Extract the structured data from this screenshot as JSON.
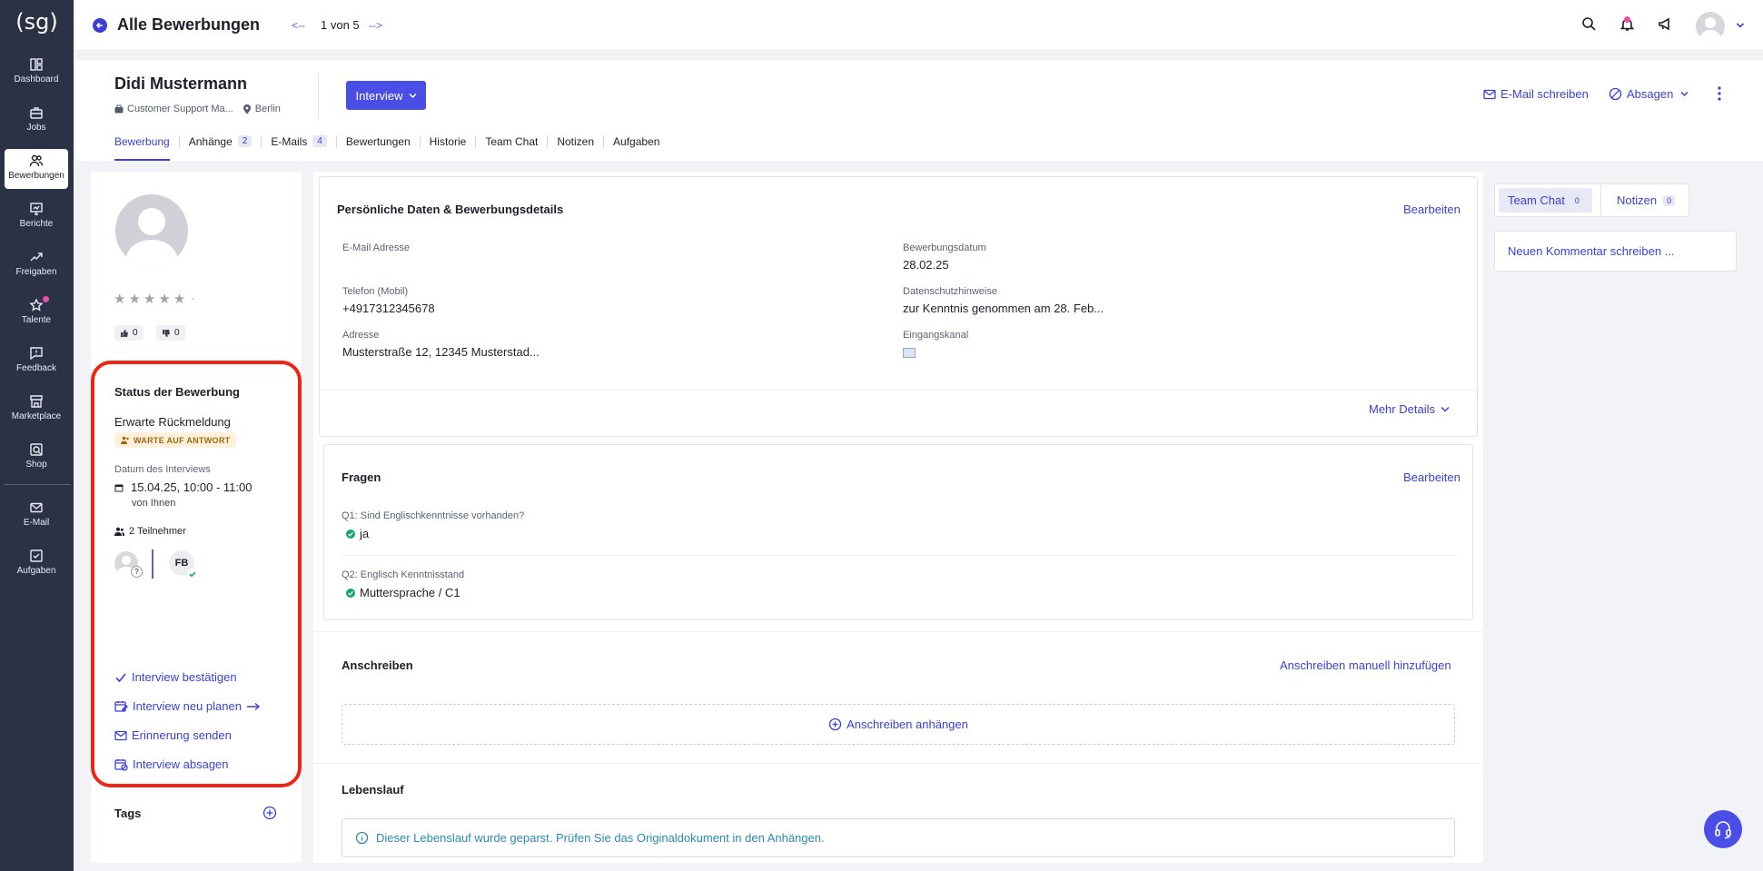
{
  "app": {
    "logo_text": "(sg)",
    "accent_color": "#3b3fd8",
    "highlight_color": "#ee2416"
  },
  "sidebar": {
    "items": [
      {
        "label": "Dashboard",
        "icon": "dashboard-icon"
      },
      {
        "label": "Jobs",
        "icon": "briefcase-icon"
      },
      {
        "label": "Bewerbungen",
        "icon": "users-icon",
        "active": true
      },
      {
        "label": "Berichte",
        "icon": "chart-icon"
      },
      {
        "label": "Freigaben",
        "icon": "handshake-icon"
      },
      {
        "label": "Talente",
        "icon": "star-icon"
      },
      {
        "label": "Feedback",
        "icon": "feedback-icon"
      },
      {
        "label": "Marketplace",
        "icon": "store-icon"
      },
      {
        "label": "Shop",
        "icon": "shop-icon"
      },
      {
        "label": "E-Mail",
        "icon": "mail-icon"
      },
      {
        "label": "Aufgaben",
        "icon": "tasks-icon"
      }
    ]
  },
  "topbar": {
    "title": "Alle Bewerbungen",
    "prev": "<--",
    "pager": "1 von 5",
    "next": "-->"
  },
  "header": {
    "candidate_name": "Didi Mustermann",
    "job": "Customer Support Ma...",
    "location": "Berlin",
    "stage_button": "Interview",
    "email_action": "E-Mail schreiben",
    "reject_action": "Absagen",
    "tabs": [
      {
        "label": "Bewerbung",
        "active": true
      },
      {
        "label": "Anhänge",
        "count": "2"
      },
      {
        "label": "E-Mails",
        "count": "4"
      },
      {
        "label": "Bewertungen"
      },
      {
        "label": "Historie"
      },
      {
        "label": "Team Chat"
      },
      {
        "label": "Notizen"
      },
      {
        "label": "Aufgaben"
      }
    ]
  },
  "left": {
    "rating_dash": "-",
    "likes": "0",
    "dislikes": "0",
    "status_title": "Status der Bewerbung",
    "status_text": "Erwarte Rückmeldung",
    "status_badge": "WARTE AUF ANTWORT",
    "interview_date_label": "Datum des Interviews",
    "interview_date": "15.04.25, 10:00 - 11:00",
    "interview_by": "von Ihnen",
    "participants": "2 Teilnehmer",
    "participant_question": "?",
    "participant_initials": "FB",
    "actions": {
      "confirm": "Interview bestätigen",
      "reschedule": "Interview neu planen",
      "reminder": "Erinnerung senden",
      "cancel": "Interview absagen"
    },
    "tags_title": "Tags"
  },
  "personal": {
    "title": "Persönliche Daten & Bewerbungsdetails",
    "edit": "Bearbeiten",
    "email_label": "E-Mail Adresse",
    "phone_label": "Telefon (Mobil)",
    "phone": "+4917312345678",
    "address_label": "Adresse",
    "address": "Musterstraße 12, 12345 Musterstad...",
    "date_label": "Bewerbungsdatum",
    "date": "28.02.25",
    "privacy_label": "Datenschutzhinweise",
    "privacy": "zur Kenntnis genommen am 28. Feb...",
    "channel_label": "Eingangskanal",
    "more": "Mehr Details"
  },
  "questions": {
    "title": "Fragen",
    "edit": "Bearbeiten",
    "q1": "Q1: Sind Englischkenntnisse vorhanden?",
    "a1": "ja",
    "q2": "Q2: Englisch Kenntnisstand",
    "a2": "Muttersprache / C1"
  },
  "cover": {
    "title": "Anschreiben",
    "add_manual": "Anschreiben manuell hinzufügen",
    "attach": "Anschreiben anhängen"
  },
  "cv": {
    "title": "Lebenslauf",
    "note": "Dieser Lebenslauf wurde geparst. Prüfen Sie das Originaldokument in den Anhängen."
  },
  "right": {
    "team_chat": "Team Chat",
    "team_chat_count": "0",
    "notes": "Notizen",
    "notes_count": "0",
    "comment_placeholder": "Neuen Kommentar schreiben ..."
  }
}
